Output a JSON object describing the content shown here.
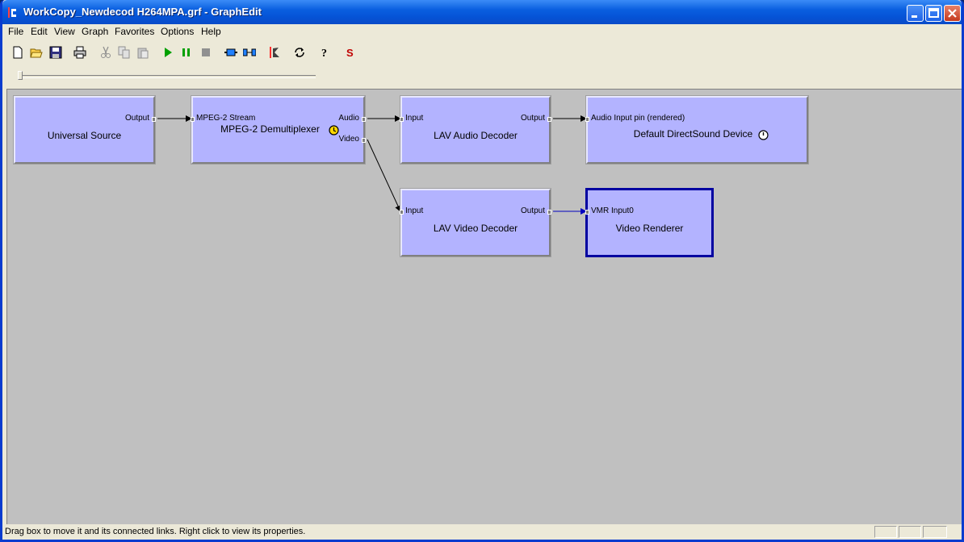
{
  "window": {
    "title": "WorkCopy_Newdecod H264MPA.grf - GraphEdit"
  },
  "menu": [
    "File",
    "Edit",
    "View",
    "Graph",
    "Favorites",
    "Options",
    "Help"
  ],
  "toolbar": [
    {
      "name": "new-icon"
    },
    {
      "name": "open-icon"
    },
    {
      "name": "save-icon"
    },
    {
      "name": "print-icon"
    },
    {
      "name": "cut-icon"
    },
    {
      "name": "copy-icon"
    },
    {
      "name": "paste-icon"
    },
    {
      "name": "play-icon"
    },
    {
      "name": "pause-icon"
    },
    {
      "name": "stop-icon"
    },
    {
      "name": "insert-filter-icon"
    },
    {
      "name": "connect-icon"
    },
    {
      "name": "graph-icon"
    },
    {
      "name": "refresh-icon"
    },
    {
      "name": "help-icon"
    },
    {
      "name": "seek-icon",
      "label": "S"
    }
  ],
  "filters": {
    "universal_source": {
      "name": "Universal Source",
      "out": "Output"
    },
    "demux": {
      "name": "MPEG-2 Demultiplexer",
      "in": "MPEG-2 Stream",
      "out_audio": "Audio",
      "out_video": "Video"
    },
    "audio_decoder": {
      "name": "LAV Audio Decoder",
      "in": "Input",
      "out": "Output"
    },
    "sound_device": {
      "name": "Default DirectSound Device",
      "in": "Audio Input pin (rendered)"
    },
    "video_decoder": {
      "name": "LAV Video Decoder",
      "in": "Input",
      "out": "Output"
    },
    "video_renderer": {
      "name": "Video Renderer",
      "in": "VMR Input0"
    }
  },
  "status": {
    "text": "Drag box to move it and its connected links. Right click to view its properties."
  },
  "colors": {
    "filter_fill": "#b3b3ff",
    "canvas": "#c0c0c0",
    "selected_border": "#0000a0",
    "selected_link": "#0000c0"
  }
}
